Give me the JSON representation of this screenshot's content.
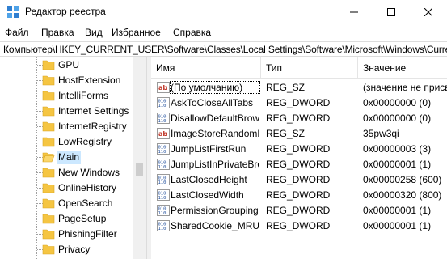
{
  "window": {
    "title": "Редактор реестра"
  },
  "menu": {
    "items": [
      "Файл",
      "Правка",
      "Вид",
      "Избранное",
      "Справка"
    ]
  },
  "address": {
    "path": "Компьютер\\HKEY_CURRENT_USER\\Software\\Classes\\Local Settings\\Software\\Microsoft\\Windows\\CurrentVersion\\AppContainer"
  },
  "tree": {
    "items": [
      {
        "label": "GPU"
      },
      {
        "label": "HostExtension"
      },
      {
        "label": "IntelliForms"
      },
      {
        "label": "Internet Settings"
      },
      {
        "label": "InternetRegistry"
      },
      {
        "label": "LowRegistry"
      },
      {
        "label": "Main"
      },
      {
        "label": "New Windows"
      },
      {
        "label": "OnlineHistory"
      },
      {
        "label": "OpenSearch"
      },
      {
        "label": "PageSetup"
      },
      {
        "label": "PhishingFilter"
      },
      {
        "label": "Privacy"
      }
    ],
    "selected_label": "Main"
  },
  "list": {
    "columns": {
      "name": "Имя",
      "type": "Тип",
      "data": "Значение"
    },
    "rows": [
      {
        "icon": "string-value-icon",
        "name": "(По умолчанию)",
        "type": "REG_SZ",
        "data": "(значение не присвоено)"
      },
      {
        "icon": "binary-value-icon",
        "name": "AskToCloseAllTabs",
        "type": "REG_DWORD",
        "data": "0x00000000 (0)"
      },
      {
        "icon": "binary-value-icon",
        "name": "DisallowDefaultBrowserPrompt",
        "type": "REG_DWORD",
        "data": "0x00000000 (0)"
      },
      {
        "icon": "string-value-icon",
        "name": "ImageStoreRandomFolder",
        "type": "REG_SZ",
        "data": "35pw3qi"
      },
      {
        "icon": "binary-value-icon",
        "name": "JumpListFirstRun",
        "type": "REG_DWORD",
        "data": "0x00000003 (3)"
      },
      {
        "icon": "binary-value-icon",
        "name": "JumpListInPrivateBrowsing",
        "type": "REG_DWORD",
        "data": "0x00000001 (1)"
      },
      {
        "icon": "binary-value-icon",
        "name": "LastClosedHeight",
        "type": "REG_DWORD",
        "data": "0x00000258 (600)"
      },
      {
        "icon": "binary-value-icon",
        "name": "LastClosedWidth",
        "type": "REG_DWORD",
        "data": "0x00000320 (800)"
      },
      {
        "icon": "binary-value-icon",
        "name": "PermissionGroupingInfo",
        "type": "REG_DWORD",
        "data": "0x00000001 (1)"
      },
      {
        "icon": "binary-value-icon",
        "name": "SharedCookie_MRU",
        "type": "REG_DWORD",
        "data": "0x00000001 (1)"
      }
    ]
  },
  "colors": {
    "selection": "#cce8ff",
    "folder": "#f5c542",
    "string_icon": "#c0392b",
    "binary_icon": "#1f4e9c"
  }
}
